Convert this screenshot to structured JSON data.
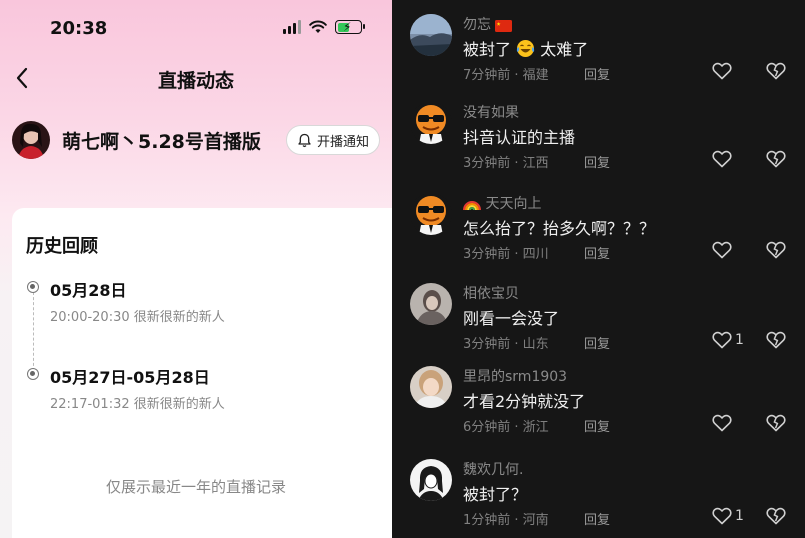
{
  "status_bar": {
    "time": "20:38",
    "battery_level": 0.55
  },
  "nav": {
    "title": "直播动态"
  },
  "profile": {
    "name": "萌七啊丶5.28号首播版",
    "notify_label": "开播通知"
  },
  "history": {
    "title": "历史回顾",
    "entries": [
      {
        "date": "05月28日",
        "detail": "20:00-20:30 很新很新的新人"
      },
      {
        "date": "05月27日-05月28日",
        "detail": "22:17-01:32 很新很新的新人"
      }
    ],
    "footer": "仅展示最近一年的直播记录"
  },
  "comments": [
    {
      "user": "勿忘",
      "text_before": "被封了",
      "text_after": "太难了",
      "time": "7分钟前 · 福建",
      "reply": "回复",
      "likes": ""
    },
    {
      "user": "没有如果",
      "text": "抖音认证的主播",
      "time": "3分钟前 · 江西",
      "reply": "回复",
      "likes": ""
    },
    {
      "user": "天天向上",
      "text": "怎么抬了？抬多久啊？？？",
      "time": "3分钟前 · 四川",
      "reply": "回复",
      "likes": ""
    },
    {
      "user": "相依宝贝",
      "text": "刚看一会没了",
      "time": "3分钟前 · 山东",
      "reply": "回复",
      "likes": "1"
    },
    {
      "user": "里昂的srm1903",
      "text": "才看2分钟就没了",
      "time": "6分钟前 · 浙江",
      "reply": "回复",
      "likes": ""
    },
    {
      "user": "魏欢几何.",
      "text": "被封了？",
      "time": "1分钟前 · 河南",
      "reply": "回复",
      "likes": "1"
    }
  ],
  "colors": {
    "accent_pink": "#f9c6dc",
    "dark_bg": "#161616",
    "battery_green": "#34c759"
  }
}
